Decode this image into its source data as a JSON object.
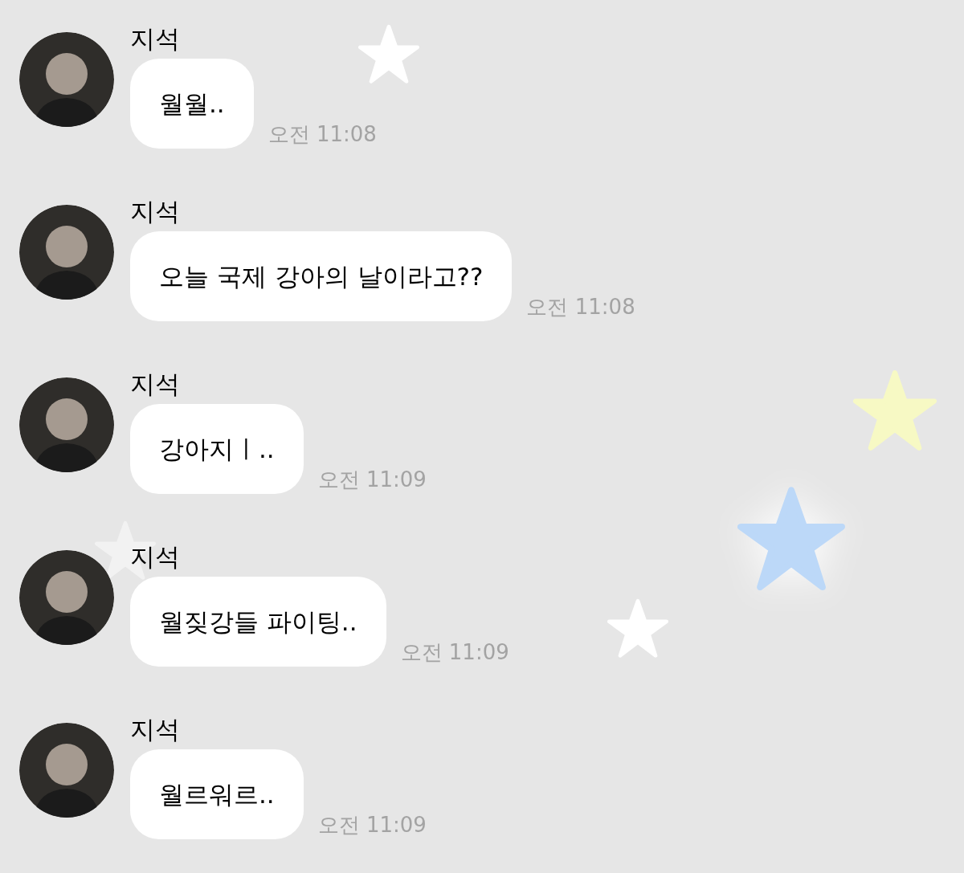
{
  "messages": [
    {
      "sender": "지석",
      "text": "월월..",
      "time": "오전 11:08"
    },
    {
      "sender": "지석",
      "text": "오늘 국제 강아의 날이라고??",
      "time": "오전 11:08"
    },
    {
      "sender": "지석",
      "text": "강아지ㅣ..",
      "time": "오전 11:09"
    },
    {
      "sender": "지석",
      "text": "월짖강들 파이팅..",
      "time": "오전 11:09"
    },
    {
      "sender": "지석",
      "text": "월르워르..",
      "time": "오전 11:09"
    }
  ]
}
